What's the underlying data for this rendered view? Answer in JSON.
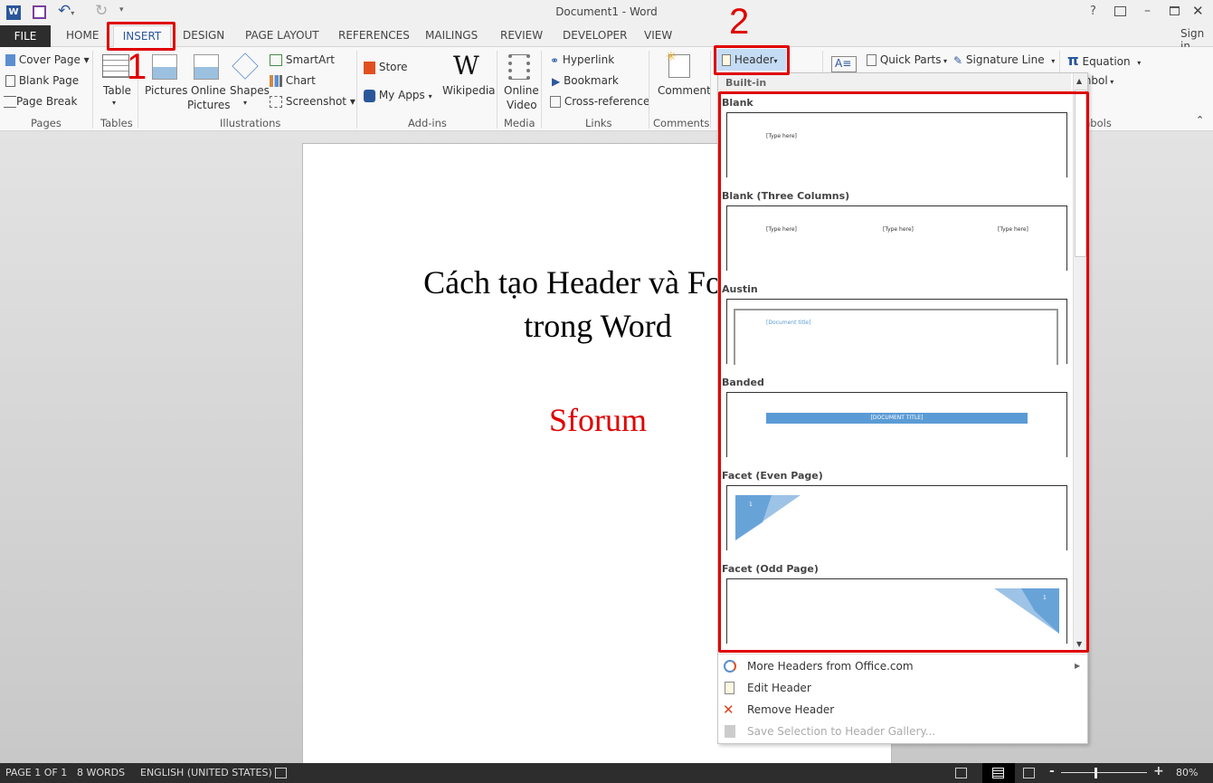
{
  "window": {
    "title": "Document1 - Word",
    "sign_in": "Sign in"
  },
  "quick_access": [
    "word-logo-icon",
    "save-icon",
    "undo-icon",
    "redo-icon",
    "customize-icon"
  ],
  "tabs": [
    {
      "label": "FILE"
    },
    {
      "label": "HOME"
    },
    {
      "label": "INSERT",
      "active": true
    },
    {
      "label": "DESIGN"
    },
    {
      "label": "PAGE LAYOUT"
    },
    {
      "label": "REFERENCES"
    },
    {
      "label": "MAILINGS"
    },
    {
      "label": "REVIEW"
    },
    {
      "label": "DEVELOPER"
    },
    {
      "label": "VIEW"
    }
  ],
  "ribbon": {
    "pages": {
      "label": "Pages",
      "cover": "Cover Page",
      "blank": "Blank Page",
      "break": "Page Break"
    },
    "tables": {
      "label": "Tables",
      "table": "Table"
    },
    "illustrations": {
      "label": "Illustrations",
      "pictures": "Pictures",
      "online_pictures_1": "Online",
      "online_pictures_2": "Pictures",
      "shapes": "Shapes",
      "smartart": "SmartArt",
      "chart": "Chart",
      "screenshot": "Screenshot"
    },
    "addins": {
      "label": "Add-ins",
      "store": "Store",
      "myapps": "My Apps",
      "wikipedia": "Wikipedia"
    },
    "media": {
      "label": "Media",
      "video_1": "Online",
      "video_2": "Video"
    },
    "links": {
      "label": "Links",
      "hyperlink": "Hyperlink",
      "bookmark": "Bookmark",
      "crossref": "Cross-reference"
    },
    "comments": {
      "label": "Comments",
      "comment": "Comment"
    },
    "header_footer": {
      "header": "Header"
    },
    "text": {
      "quick_parts": "Quick Parts",
      "signature": "Signature Line"
    },
    "symbols": {
      "label": "Symbols",
      "equation": "Equation",
      "symbol": "Symbol"
    }
  },
  "document": {
    "title_line1": "Cách tạo Header và Footer",
    "title_line2": "trong Word",
    "subtitle": "Sforum",
    "subtitle_color": "#e00000"
  },
  "header_menu": {
    "section": "Built-in",
    "gallery": [
      {
        "name": "Blank",
        "placeholders": [
          "[Type here]"
        ]
      },
      {
        "name": "Blank (Three Columns)",
        "placeholders": [
          "[Type here]",
          "[Type here]",
          "[Type here]"
        ]
      },
      {
        "name": "Austin",
        "placeholders": [
          "[Document title]"
        ]
      },
      {
        "name": "Banded",
        "placeholders": [
          "[DOCUMENT TITLE]"
        ]
      },
      {
        "name": "Facet (Even Page)",
        "placeholders": [
          "1"
        ]
      },
      {
        "name": "Facet (Odd Page)",
        "placeholders": [
          "1"
        ]
      }
    ],
    "items": [
      {
        "label": "More Headers from Office.com",
        "enabled": true
      },
      {
        "label": "Edit Header",
        "enabled": true
      },
      {
        "label": "Remove Header",
        "enabled": true
      },
      {
        "label": "Save Selection to Header Gallery...",
        "enabled": false
      }
    ]
  },
  "annotations": {
    "step1": "1",
    "step2": "2",
    "color": "#e00000"
  },
  "status": {
    "page": "PAGE 1 OF 1",
    "words": "8 WORDS",
    "language": "ENGLISH (UNITED STATES)",
    "zoom": "80%",
    "zoom_level_percent": 80
  }
}
